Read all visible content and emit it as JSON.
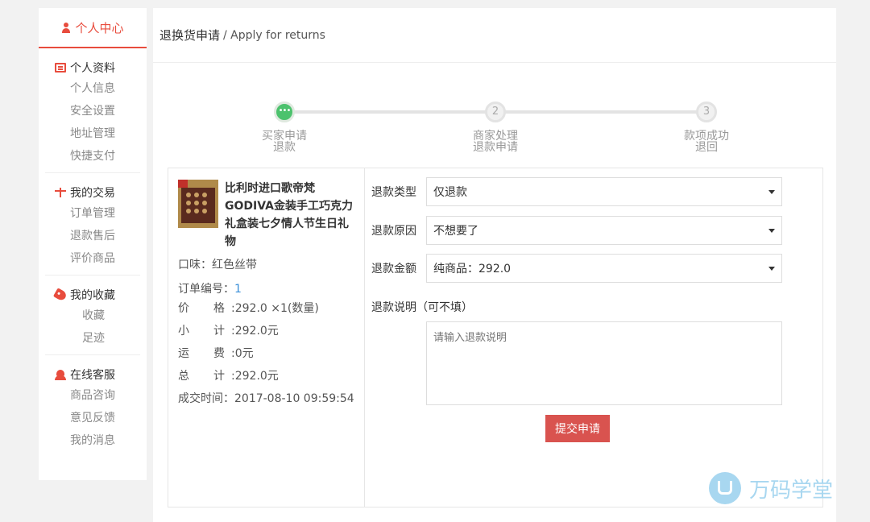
{
  "sidebar": {
    "header": "个人中心",
    "groups": [
      {
        "title": "个人资料",
        "icon": "id-card-icon",
        "items": [
          "个人信息",
          "安全设置",
          "地址管理",
          "快捷支付"
        ]
      },
      {
        "title": "我的交易",
        "icon": "scale-icon",
        "items": [
          "订单管理",
          "退款售后",
          "评价商品"
        ]
      },
      {
        "title": "我的收藏",
        "icon": "tag-icon",
        "items": [
          "收藏",
          "足迹"
        ]
      },
      {
        "title": "在线客服",
        "icon": "customer-service-icon",
        "items": [
          "商品咨询",
          "意见反馈",
          "我的消息"
        ]
      }
    ]
  },
  "header": {
    "title": "退换货申请",
    "subtitle": "/ Apply for returns"
  },
  "steps": [
    {
      "marker": "•••",
      "label1": "买家申请",
      "label2": "退款"
    },
    {
      "marker": "2",
      "label1": "商家处理",
      "label2": "退款申请"
    },
    {
      "marker": "3",
      "label1": "款项成功",
      "label2": "退回"
    }
  ],
  "product": {
    "name": "比利时进口歌帝梵GODIVA金装手工巧克力礼盒装七夕情人节生日礼物",
    "flavor": "口味：红色丝带",
    "order_label": "订单编号：",
    "order_no": "1",
    "price_k1": "价",
    "price_k2": "格",
    "price_v": ":292.0 ×1(数量)",
    "subtotal_k1": "小",
    "subtotal_k2": "计",
    "subtotal_v": ":292.0元",
    "shipping_k1": "运",
    "shipping_k2": "费",
    "shipping_v": ":0元",
    "total_k1": "总",
    "total_k2": "计",
    "total_v": ":292.0元",
    "deal_time": "成交时间：2017-08-10 09:59:54"
  },
  "form": {
    "type_label": "退款类型",
    "type_value": "仅退款",
    "reason_label": "退款原因",
    "reason_value": "不想要了",
    "amount_label": "退款金额",
    "amount_value": "纯商品：292.0",
    "note_label": "退款说明（可不填）",
    "note_placeholder": "请输入退款说明",
    "submit": "提交申请"
  },
  "watermark": "万码学堂",
  "colors": {
    "accent": "#e84c3d",
    "step_active": "#4cc26d",
    "submit": "#d9534f",
    "link": "#3a8fd8"
  }
}
